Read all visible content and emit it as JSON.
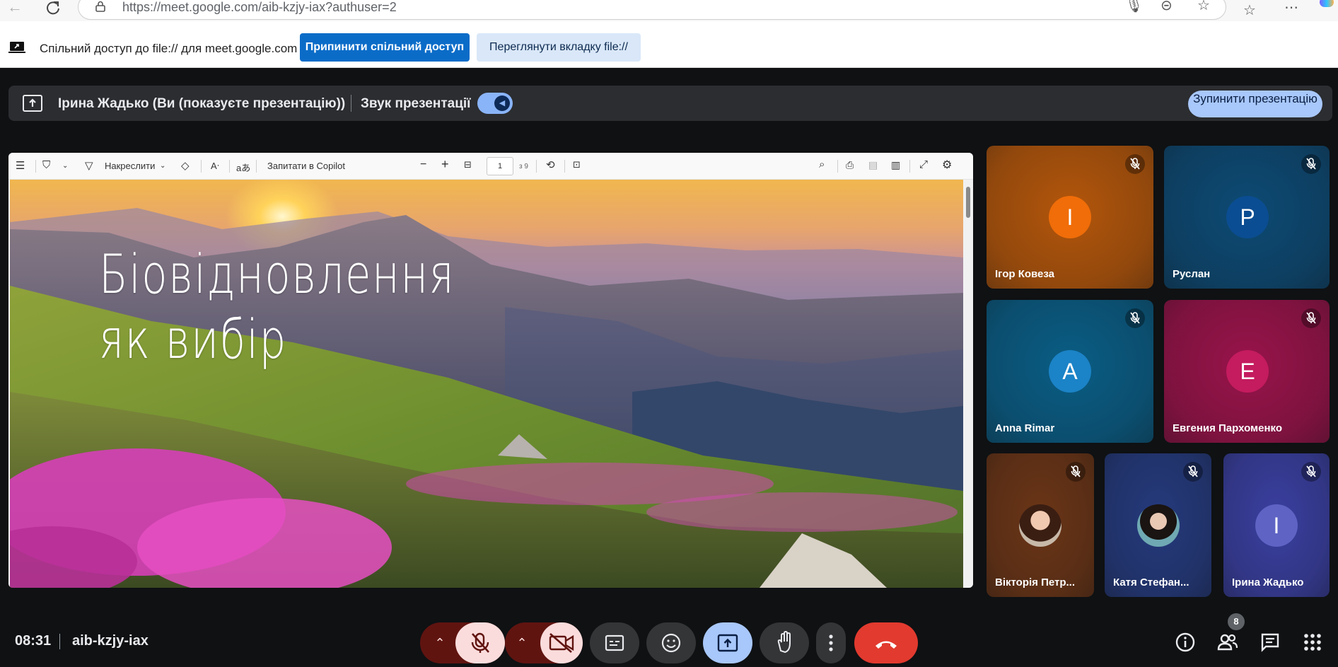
{
  "browser": {
    "url": "https://meet.google.com/aib-kzjy-iax?authuser=2"
  },
  "share_bar": {
    "message": "Спільний доступ до file:// для meet.google.com",
    "stop_sharing_label": "Припинити спільний доступ",
    "view_tab_label": "Переглянути вкладку file://"
  },
  "presenting": {
    "presenter_text": "Ірина Жадько (Ви (показуєте презентацію))",
    "sound_label": "Звук презентації",
    "sound_on": true,
    "stop_label": "Зупинити презентацію"
  },
  "pdf_toolbar": {
    "draw_label": "Накреслити",
    "copilot_label": "Запитати в Copilot",
    "page_current": "1",
    "page_total": "з 9"
  },
  "slide": {
    "title_line1": "Біовідновлення",
    "title_line2": "як вибір"
  },
  "participants": [
    {
      "name": "Ігор Ковеза",
      "initial": "І",
      "bg": "#b3560b",
      "avatar_color": "#f06d09",
      "muted": true
    },
    {
      "name": "Руслан",
      "initial": "Р",
      "bg": "#0d4a74",
      "avatar_color": "#0b4d92",
      "muted": true
    },
    {
      "name": "Anna Rimar",
      "initial": "A",
      "bg": "#0a5d85",
      "avatar_color": "#1b83c7",
      "muted": true
    },
    {
      "name": "Евгения Пархоменко",
      "initial": "E",
      "bg": "#99134a",
      "avatar_color": "#c41c5e",
      "muted": true
    },
    {
      "name": "Вікторія Петр...",
      "initial": "",
      "bg": "#6b3516",
      "avatar_color": "",
      "muted": true
    },
    {
      "name": "Катя Стефан...",
      "initial": "",
      "bg": "#253a7d",
      "avatar_color": "",
      "muted": true
    },
    {
      "name": "Ірина Жадько",
      "initial": "І",
      "bg": "#3a3fa0",
      "avatar_color": "#5e63c4",
      "muted": true
    }
  ],
  "bottom": {
    "time": "08:31",
    "meeting_code": "aib-kzjy-iax",
    "participant_count": "8"
  },
  "colors": {
    "end_call": "#e23a2f",
    "present_active": "#a8c7fa",
    "muted_bg": "#fbdcdc",
    "muted_arrow_bg": "#601410"
  }
}
